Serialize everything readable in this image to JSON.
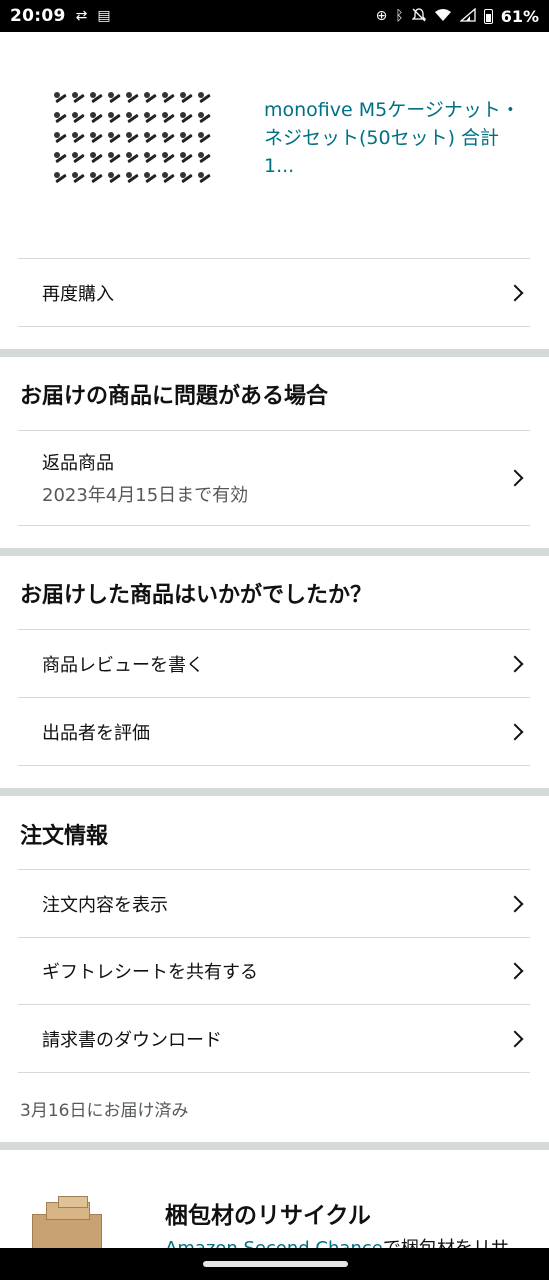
{
  "status_bar": {
    "time": "20:09",
    "battery": "61%",
    "icons": [
      "sync-icon",
      "vpn-icon",
      "location-target-icon",
      "bluetooth-icon",
      "bell-off-icon",
      "wifi-icon",
      "signal-icon",
      "battery-icon"
    ]
  },
  "product": {
    "title": "monofive M5ケージナット・ネジセット(50セット) 合計1..."
  },
  "actions": {
    "buy_again": "再度購入"
  },
  "problem_section": {
    "heading": "お届けの商品に問題がある場合",
    "return_label": "返品商品",
    "return_deadline": "2023年4月15日まで有効"
  },
  "feedback_section": {
    "heading": "お届けした商品はいかがでしたか？",
    "write_review": "商品レビューを書く",
    "rate_seller": "出品者を評価"
  },
  "order_info": {
    "heading": "注文情報",
    "view_details": "注文内容を表示",
    "share_gift_receipt": "ギフトレシートを共有する",
    "download_invoice": "請求書のダウンロード",
    "delivered_text": "3月16日にお届け済み"
  },
  "recycle": {
    "title": "梱包材のリサイクル",
    "link_text": "Amazon Second Chance",
    "desc_rest": "で梱包材をリサ"
  }
}
